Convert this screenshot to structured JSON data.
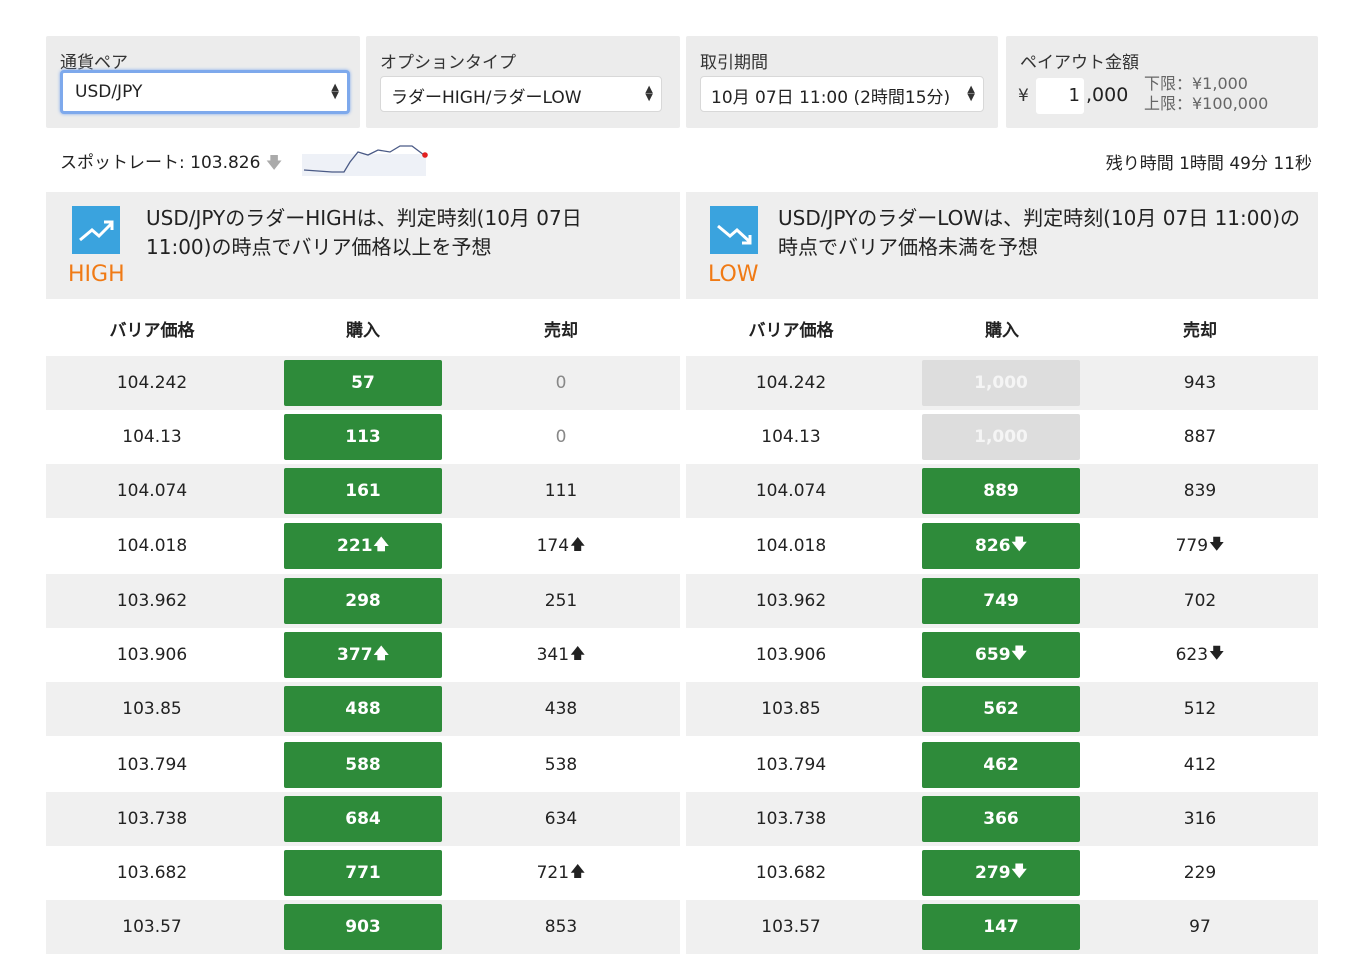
{
  "currency_pair": {
    "label": "通貨ペア",
    "value": "USD/JPY"
  },
  "option_type": {
    "label": "オプションタイプ",
    "value": "ラダーHIGH/ラダーLOW"
  },
  "trade_period": {
    "label": "取引期間",
    "value": "10月 07日 11:00 (2時間15分)"
  },
  "payout": {
    "label": "ペイアウト金額",
    "currency_symbol": "¥",
    "input_value": "1",
    "suffix": ",000",
    "min_label": "下限：¥1,000",
    "max_label": "上限：¥100,000"
  },
  "spot": {
    "label": "スポットレート:",
    "value": "103.826",
    "trend": "down"
  },
  "remaining_time": "残り時間 1時間 49分 11秒",
  "high": {
    "label": "HIGH",
    "description": "USD/JPYのラダーHIGHは、判定時刻(10月 07日 11:00)の時点でバリア価格以上を予想",
    "headers": {
      "barrier": "バリア価格",
      "buy": "購入",
      "sell": "売却"
    },
    "rows": [
      {
        "barrier": "104.242",
        "buy": "57",
        "buy_arrow": "",
        "sell": "0",
        "sell_arrow": ""
      },
      {
        "barrier": "104.13",
        "buy": "113",
        "buy_arrow": "",
        "sell": "0",
        "sell_arrow": ""
      },
      {
        "barrier": "104.074",
        "buy": "161",
        "buy_arrow": "",
        "sell": "111",
        "sell_arrow": ""
      },
      {
        "barrier": "104.018",
        "buy": "221",
        "buy_arrow": "up",
        "sell": "174",
        "sell_arrow": "up"
      },
      {
        "barrier": "103.962",
        "buy": "298",
        "buy_arrow": "",
        "sell": "251",
        "sell_arrow": ""
      },
      {
        "barrier": "103.906",
        "buy": "377",
        "buy_arrow": "up",
        "sell": "341",
        "sell_arrow": "up"
      },
      {
        "barrier": "103.85",
        "buy": "488",
        "buy_arrow": "",
        "sell": "438",
        "sell_arrow": ""
      },
      {
        "barrier": "103.794",
        "buy": "588",
        "buy_arrow": "",
        "sell": "538",
        "sell_arrow": ""
      },
      {
        "barrier": "103.738",
        "buy": "684",
        "buy_arrow": "",
        "sell": "634",
        "sell_arrow": ""
      },
      {
        "barrier": "103.682",
        "buy": "771",
        "buy_arrow": "",
        "sell": "721",
        "sell_arrow": "up"
      },
      {
        "barrier": "103.57",
        "buy": "903",
        "buy_arrow": "",
        "sell": "853",
        "sell_arrow": ""
      }
    ]
  },
  "low": {
    "label": "LOW",
    "description": "USD/JPYのラダーLOWは、判定時刻(10月 07日 11:00)の時点でバリア価格未満を予想",
    "headers": {
      "barrier": "バリア価格",
      "buy": "購入",
      "sell": "売却"
    },
    "rows": [
      {
        "barrier": "104.242",
        "buy": "1,000",
        "buy_arrow": "",
        "disabled": true,
        "sell": "943",
        "sell_arrow": ""
      },
      {
        "barrier": "104.13",
        "buy": "1,000",
        "buy_arrow": "",
        "disabled": true,
        "sell": "887",
        "sell_arrow": ""
      },
      {
        "barrier": "104.074",
        "buy": "889",
        "buy_arrow": "",
        "disabled": false,
        "sell": "839",
        "sell_arrow": ""
      },
      {
        "barrier": "104.018",
        "buy": "826",
        "buy_arrow": "down",
        "disabled": false,
        "sell": "779",
        "sell_arrow": "down"
      },
      {
        "barrier": "103.962",
        "buy": "749",
        "buy_arrow": "",
        "disabled": false,
        "sell": "702",
        "sell_arrow": ""
      },
      {
        "barrier": "103.906",
        "buy": "659",
        "buy_arrow": "down",
        "disabled": false,
        "sell": "623",
        "sell_arrow": "down"
      },
      {
        "barrier": "103.85",
        "buy": "562",
        "buy_arrow": "",
        "disabled": false,
        "sell": "512",
        "sell_arrow": ""
      },
      {
        "barrier": "103.794",
        "buy": "462",
        "buy_arrow": "",
        "disabled": false,
        "sell": "412",
        "sell_arrow": ""
      },
      {
        "barrier": "103.738",
        "buy": "366",
        "buy_arrow": "",
        "disabled": false,
        "sell": "316",
        "sell_arrow": ""
      },
      {
        "barrier": "103.682",
        "buy": "279",
        "buy_arrow": "down",
        "disabled": false,
        "sell": "229",
        "sell_arrow": ""
      },
      {
        "barrier": "103.57",
        "buy": "147",
        "buy_arrow": "",
        "disabled": false,
        "sell": "97",
        "sell_arrow": ""
      }
    ]
  },
  "colors": {
    "buy_button": "#2e8b3a",
    "disabled_button": "#dddddd",
    "direction_label": "#f07a14",
    "icon_bg": "#3aa3de",
    "focus_border": "#7ea9ec"
  }
}
